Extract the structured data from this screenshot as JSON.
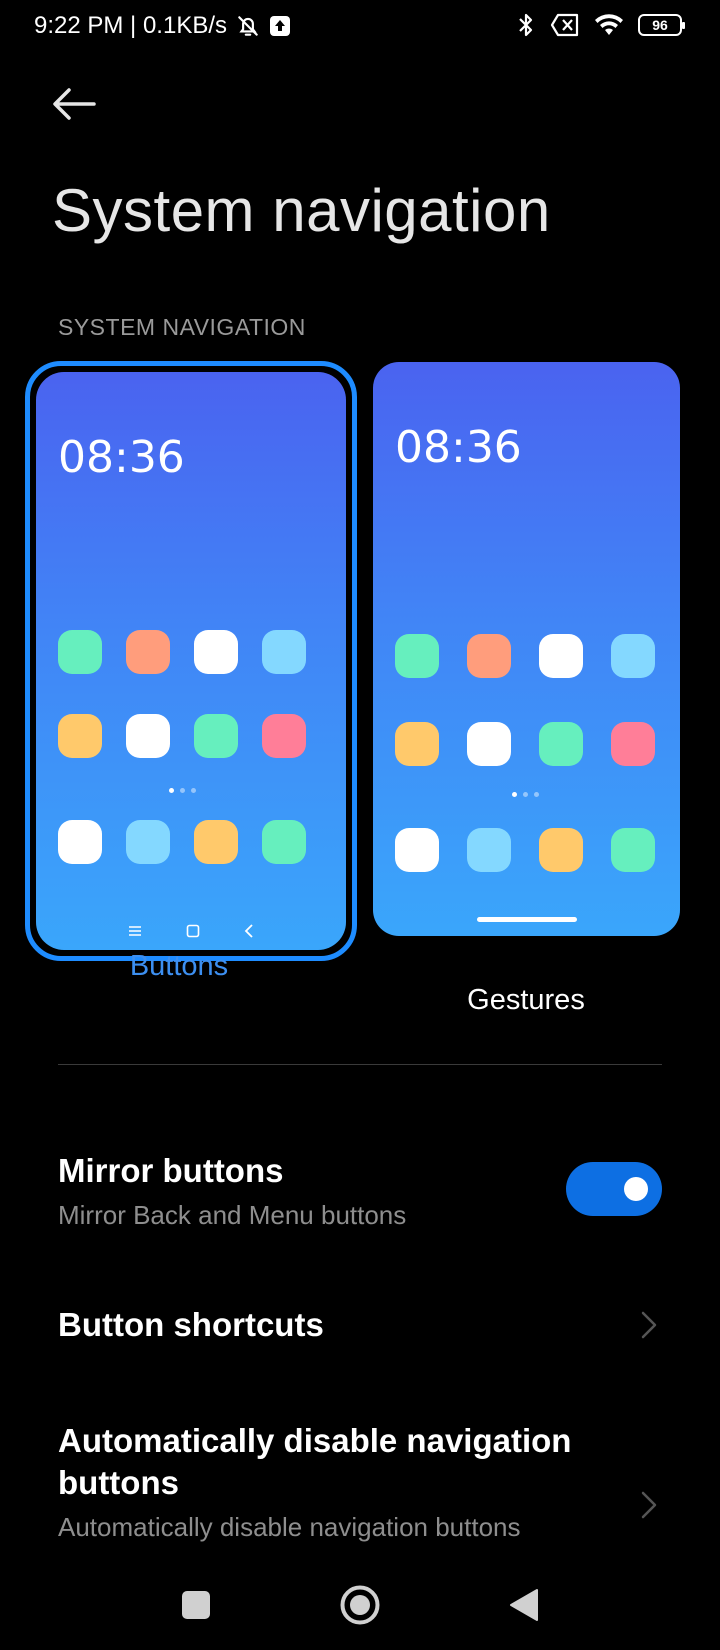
{
  "status_bar": {
    "time_speed": "9:22 PM | 0.1KB/s",
    "battery": "96"
  },
  "header": {
    "title": "System navigation",
    "section_label": "SYSTEM NAVIGATION"
  },
  "options": [
    {
      "label": "Buttons",
      "time": "08:36",
      "selected": true
    },
    {
      "label": "Gestures",
      "time": "08:36",
      "selected": false
    }
  ],
  "app_colors": {
    "green": "#66efbe",
    "salmon": "#ff9d7c",
    "white": "#ffffff",
    "sky": "#84d8ff",
    "yellow": "#ffc96b",
    "pink": "#ff7e98"
  },
  "rows": {
    "mirror": {
      "title": "Mirror buttons",
      "subtitle": "Mirror Back and Menu buttons",
      "enabled": true
    },
    "shortcuts": {
      "title": "Button shortcuts"
    },
    "auto_disable": {
      "title": "Automatically disable navigation buttons",
      "subtitle": "Automatically disable navigation buttons"
    }
  },
  "colors": {
    "accent": "#1e8cff",
    "toggle_on": "#0d6fe3",
    "selected_label": "#3d8ff0"
  }
}
